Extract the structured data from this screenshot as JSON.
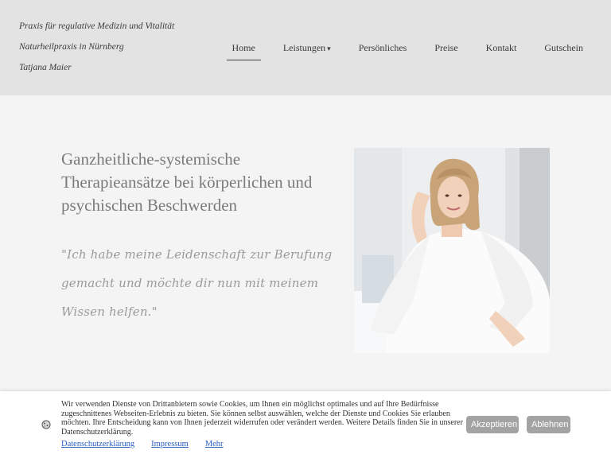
{
  "header": {
    "brand_lines": [
      "Praxis für regulative Medizin und Vitalität",
      "Naturheilpraxis in Nürnberg",
      "Tatjana Maier"
    ]
  },
  "nav": {
    "items": [
      {
        "label": "Home",
        "active": true
      },
      {
        "label": "Leistungen",
        "caret": "▾"
      },
      {
        "label": "Persönliches"
      },
      {
        "label": "Preise"
      },
      {
        "label": "Kontakt"
      },
      {
        "label": "Gutschein"
      }
    ]
  },
  "hero": {
    "headline": "Ganzheitliche-systemische Therapieansätze bei körperlichen und psychischen Beschwerden",
    "quote": "\"Ich habe meine Leidenschaft zur Berufung gemacht und möchte dir nun mit meinem Wissen helfen.\""
  },
  "cookie": {
    "text": "Wir verwenden Dienste von Drittanbietern sowie Cookies, um Ihnen ein möglichst optimales und auf Ihre Bedürfnisse zugeschnittenes Webseiten-Erlebnis zu bieten. Sie können selbst auswählen, welche der Dienste und Cookies Sie erlauben möchten. Ihre Entscheidung kann von Ihnen jederzeit widerrufen oder verändert werden. Weitere Details finden Sie in unserer Datenschutzerklärung.",
    "links": [
      "Datenschutzerklärung",
      "Impressum",
      "Mehr"
    ],
    "accept_label": "Akzeptieren",
    "reject_label": "Ablehnen"
  },
  "colors": {
    "header_bg": "#e3e3e3",
    "page_bg": "#f4f4f4",
    "button_bg": "#a3a3a3",
    "link": "#2a5fc0"
  }
}
